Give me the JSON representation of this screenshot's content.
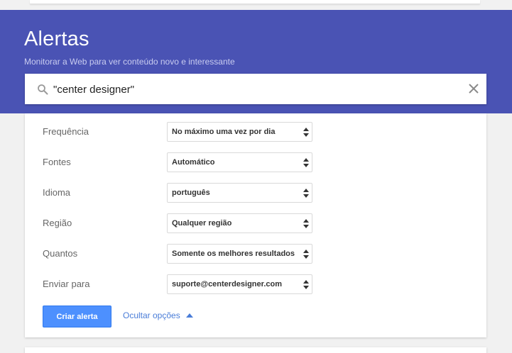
{
  "header": {
    "title": "Alertas",
    "subtitle": "Monitorar a Web para ver conteúdo novo e interessante"
  },
  "search": {
    "value": "\"center designer\"",
    "icon": "search-icon",
    "clear_icon": "close-icon"
  },
  "options": [
    {
      "label": "Frequência",
      "value": "No máximo uma vez por dia"
    },
    {
      "label": "Fontes",
      "value": "Automático"
    },
    {
      "label": "Idioma",
      "value": "português"
    },
    {
      "label": "Região",
      "value": "Qualquer região"
    },
    {
      "label": "Quantos",
      "value": "Somente os melhores resultados"
    },
    {
      "label": "Enviar para",
      "value": "suporte@centerdesigner.com"
    }
  ],
  "actions": {
    "create_label": "Criar alerta",
    "hide_options_label": "Ocultar opções"
  },
  "colors": {
    "header_bg": "#4a53b4",
    "primary_button": "#4d90fe",
    "link": "#4a7dd8",
    "page_bg": "#f1f1f1"
  }
}
